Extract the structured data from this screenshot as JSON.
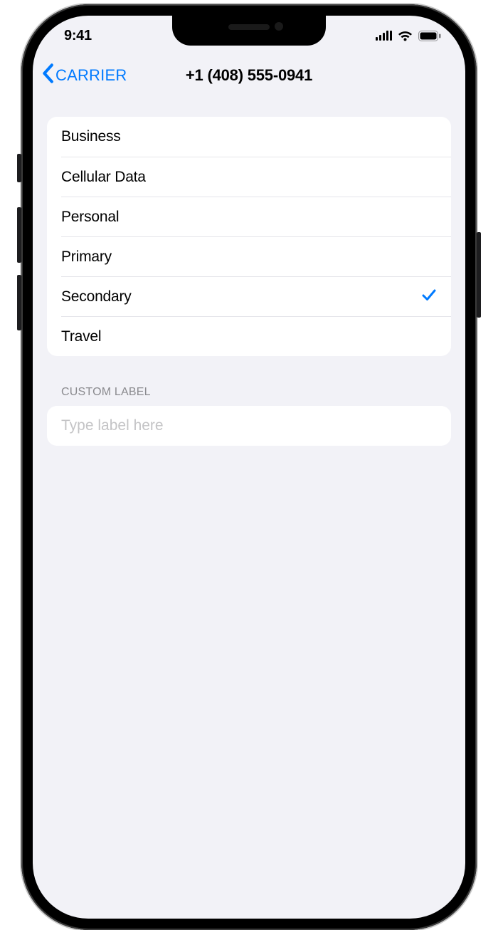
{
  "statusBar": {
    "time": "9:41"
  },
  "nav": {
    "backLabel": "CARRIER",
    "title": "+1 (408) 555-0941"
  },
  "labels": [
    {
      "label": "Business",
      "selected": false
    },
    {
      "label": "Cellular Data",
      "selected": false
    },
    {
      "label": "Personal",
      "selected": false
    },
    {
      "label": "Primary",
      "selected": false
    },
    {
      "label": "Secondary",
      "selected": true
    },
    {
      "label": "Travel",
      "selected": false
    }
  ],
  "customLabel": {
    "header": "CUSTOM LABEL",
    "placeholder": "Type label here",
    "value": ""
  },
  "colors": {
    "accent": "#007aff",
    "background": "#f2f2f7"
  }
}
